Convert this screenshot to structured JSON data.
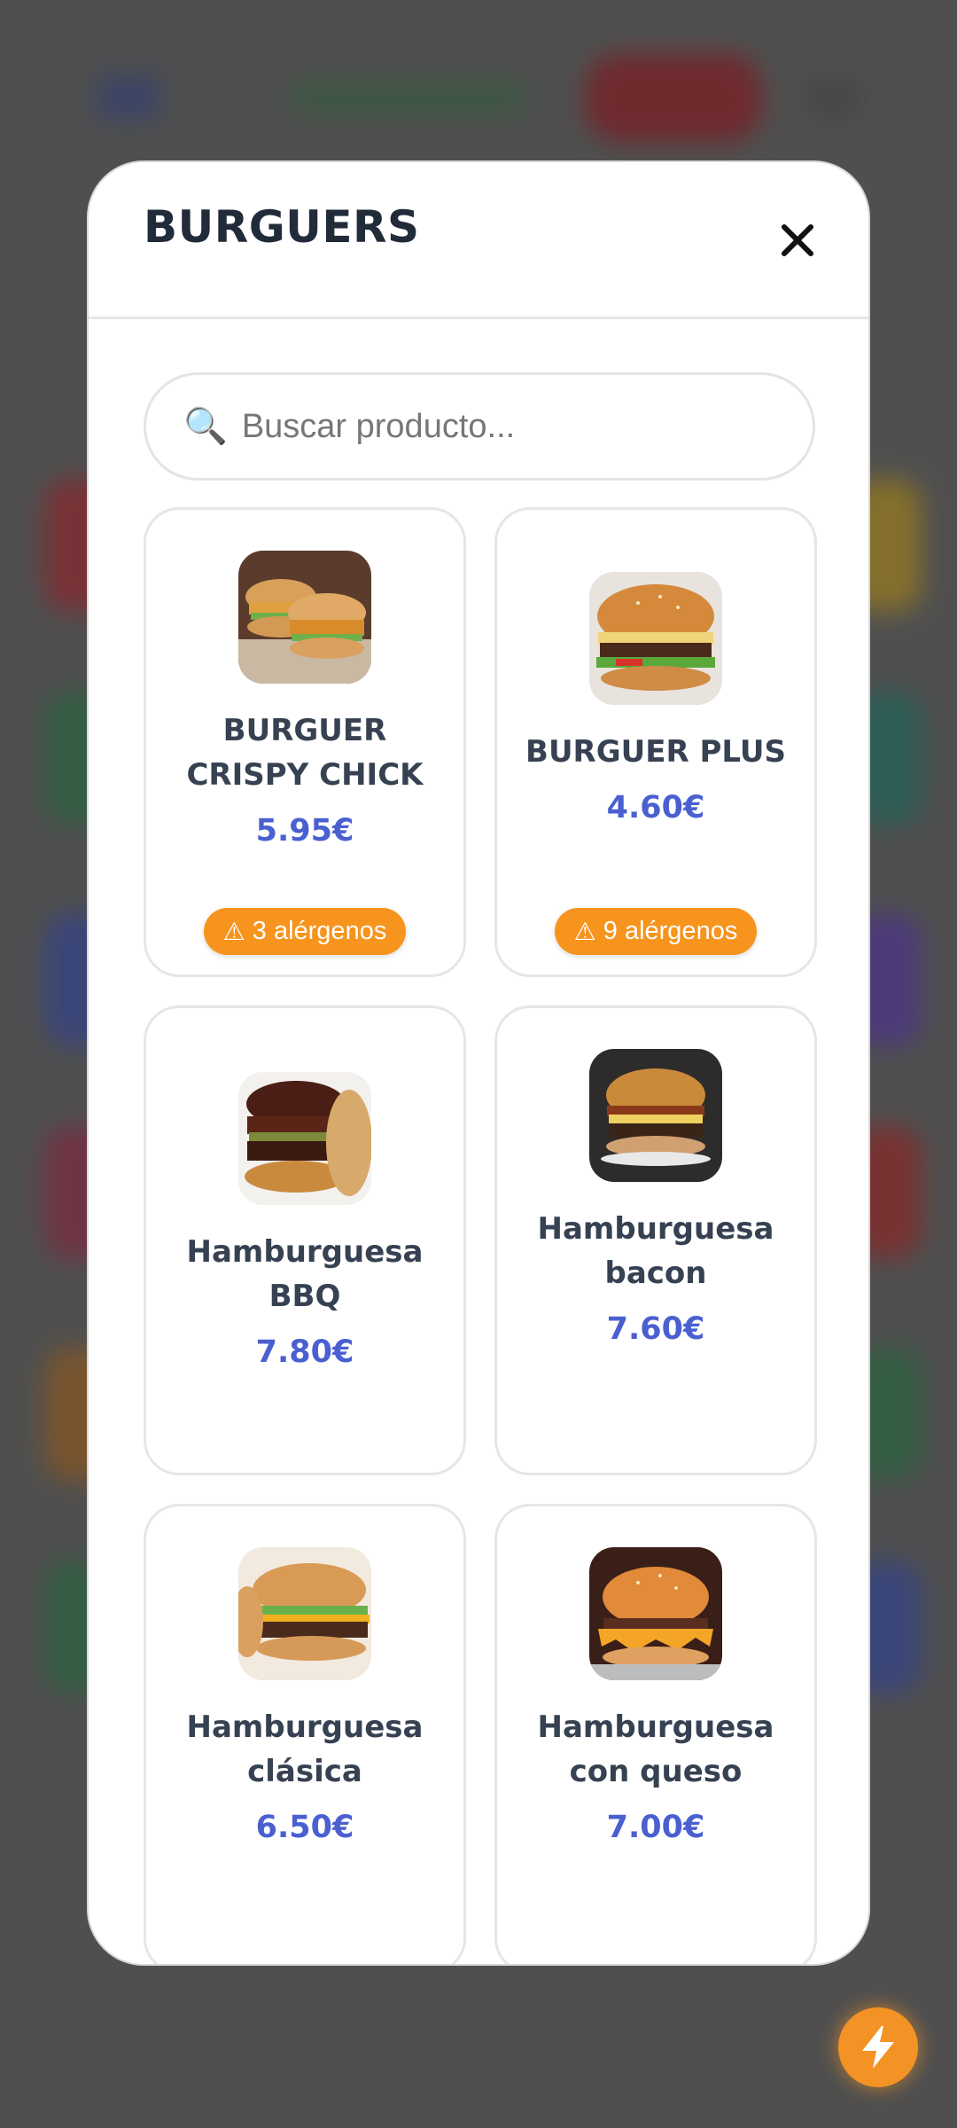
{
  "modal": {
    "title": "BURGUERS",
    "search_placeholder": "Buscar producto..."
  },
  "products": [
    {
      "name": "BURGUER CRISPY CHICK",
      "price": "5.95€",
      "allergens": "3 alérgenos",
      "image": "crispy-chicken-burger-image"
    },
    {
      "name": "BURGUER PLUS",
      "price": "4.60€",
      "allergens": "9 alérgenos",
      "image": "burger-plus-image"
    },
    {
      "name": "Hamburguesa BBQ",
      "price": "7.80€",
      "allergens": "",
      "image": "bbq-burger-image"
    },
    {
      "name": "Hamburguesa bacon",
      "price": "7.60€",
      "allergens": "",
      "image": "bacon-burger-image"
    },
    {
      "name": "Hamburguesa clásica",
      "price": "6.50€",
      "allergens": "",
      "image": "classic-burger-image"
    },
    {
      "name": "Hamburguesa con queso",
      "price": "7.00€",
      "allergens": "",
      "image": "cheese-burger-image"
    }
  ],
  "icons": {
    "close": "close-icon",
    "search": "magnifier-icon",
    "warning": "warning-icon",
    "fab": "lightning-icon"
  },
  "colors": {
    "price": "#4a5fd0",
    "badge": "#f7941d",
    "fab": "#f39325"
  }
}
